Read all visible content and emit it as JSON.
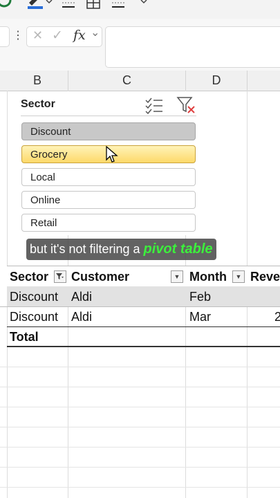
{
  "toolbar": {
    "icons": [
      "check-circle-icon",
      "pen-icon",
      "chevron-down-icon",
      "border-bottom-icon",
      "grid-icon",
      "border-icon",
      "overflow-icon"
    ]
  },
  "formula_bar": {
    "fx_label": "fx",
    "cancel_glyph": "✕",
    "confirm_glyph": "✓",
    "more_glyph": "⋮",
    "dropdown_glyph": "⌄"
  },
  "columns": [
    "B",
    "C",
    "D"
  ],
  "slicer": {
    "title": "Sector",
    "items": [
      {
        "label": "Discount",
        "state": "selected"
      },
      {
        "label": "Grocery",
        "state": "hover"
      },
      {
        "label": "Local",
        "state": "normal"
      },
      {
        "label": "Online",
        "state": "normal"
      },
      {
        "label": "Retail",
        "state": "normal"
      }
    ]
  },
  "caption": {
    "text": "but it's not filtering a",
    "highlight": "pivot table",
    "highlight_color": "#3cf03c"
  },
  "pivot": {
    "headers": [
      "Sector",
      "Customer",
      "Month",
      "Reve"
    ],
    "rows": [
      [
        "Discount",
        "Aldi",
        "Feb",
        ""
      ],
      [
        "Discount",
        "Aldi",
        "Mar",
        "2"
      ]
    ],
    "total_label": "Total"
  },
  "colors": {
    "selected": "#c8c8c8",
    "hover": "#fdd96a",
    "accent_filter_clear": "#e04040"
  }
}
